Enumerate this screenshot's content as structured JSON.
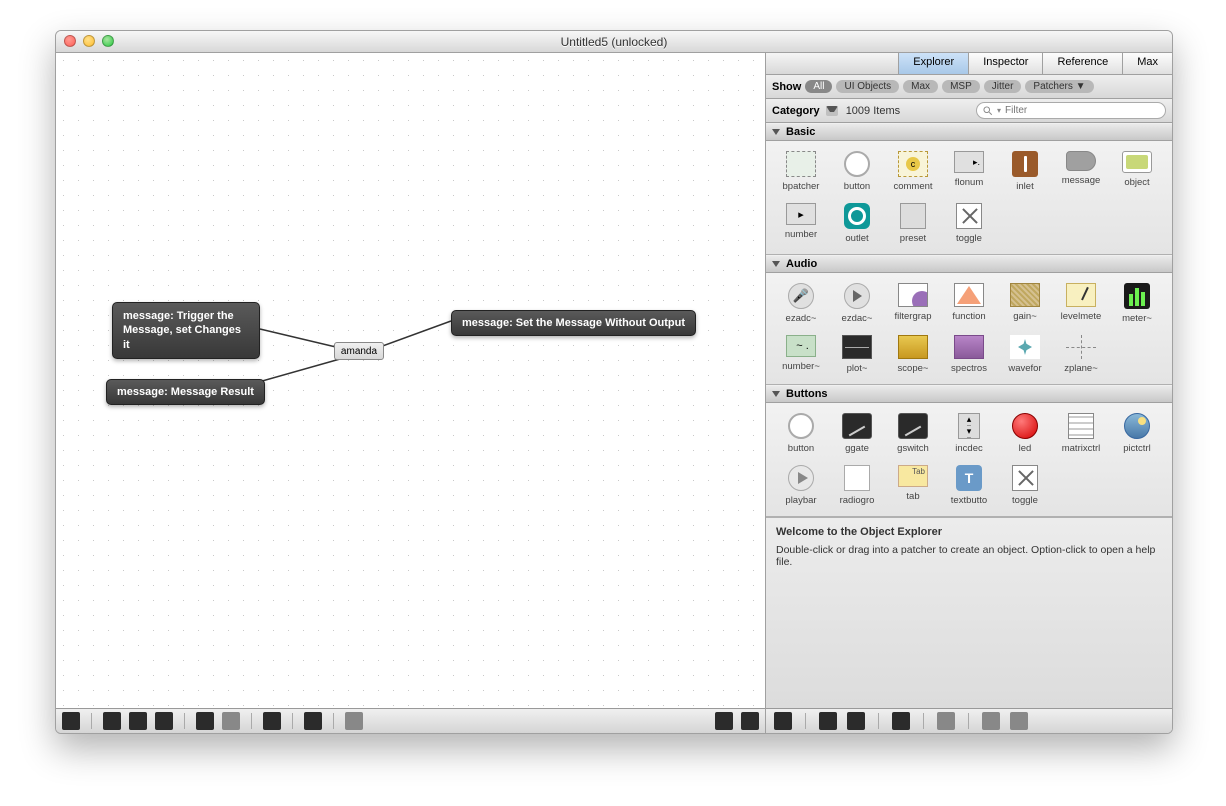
{
  "window": {
    "title": "Untitled5 (unlocked)"
  },
  "canvas": {
    "tooltip1": "message: Trigger the Message, set Changes it",
    "tooltip2": "message: Set the Message Without Output",
    "tooltip3": "message: Message Result",
    "msgbox_text": "amanda"
  },
  "tabs": {
    "explorer": "Explorer",
    "inspector": "Inspector",
    "reference": "Reference",
    "max": "Max"
  },
  "filter": {
    "show_label": "Show",
    "pills": {
      "all": "All",
      "ui": "UI Objects",
      "max": "Max",
      "msp": "MSP",
      "jitter": "Jitter",
      "patchers": "Patchers ▼"
    }
  },
  "catbar": {
    "category_label": "Category",
    "count": "1009 Items",
    "search_placeholder": "Filter"
  },
  "sections": {
    "basic": {
      "title": "Basic",
      "items": [
        "bpatcher",
        "button",
        "comment",
        "flonum",
        "inlet",
        "message",
        "object",
        "number",
        "outlet",
        "preset",
        "toggle"
      ]
    },
    "audio": {
      "title": "Audio",
      "items": [
        "ezadc~",
        "ezdac~",
        "filtergrap",
        "function",
        "gain~",
        "levelmete",
        "meter~",
        "number~",
        "plot~",
        "scope~",
        "spectros",
        "wavefor",
        "zplane~"
      ]
    },
    "buttons": {
      "title": "Buttons",
      "items": [
        "button",
        "ggate",
        "gswitch",
        "incdec",
        "led",
        "matrixctrl",
        "pictctrl",
        "playbar",
        "radiogro",
        "tab",
        "textbutto",
        "toggle"
      ]
    }
  },
  "help": {
    "title": "Welcome to the Object Explorer",
    "body": "Double-click or drag into a patcher to create an object. Option-click to open a help file."
  }
}
